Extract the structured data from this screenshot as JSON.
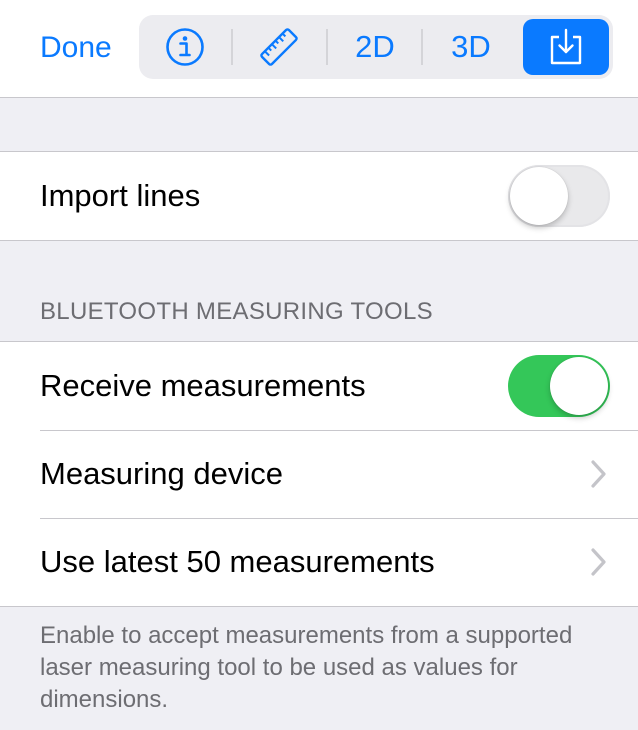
{
  "navbar": {
    "done_label": "Done",
    "segments": {
      "info_icon": "info-circle-icon",
      "ruler_icon": "ruler-icon",
      "label_2d": "2D",
      "label_3d": "3D",
      "export_icon": "import-tray-icon",
      "selected": "export"
    }
  },
  "import_group": {
    "import_lines_label": "Import lines",
    "import_lines_on": false
  },
  "bluetooth_section": {
    "header": "BLUETOOTH MEASURING TOOLS",
    "receive_label": "Receive measurements",
    "receive_on": true,
    "device_label": "Measuring device",
    "latest_label": "Use latest 50 measurements",
    "footer": "Enable to accept measurements from a supported laser measuring tool to be used as values for dimensions."
  },
  "colors": {
    "accent": "#0a7aff",
    "toggle_on": "#34c759",
    "toggle_off": "#e9e9eb",
    "background": "#efeff4"
  }
}
